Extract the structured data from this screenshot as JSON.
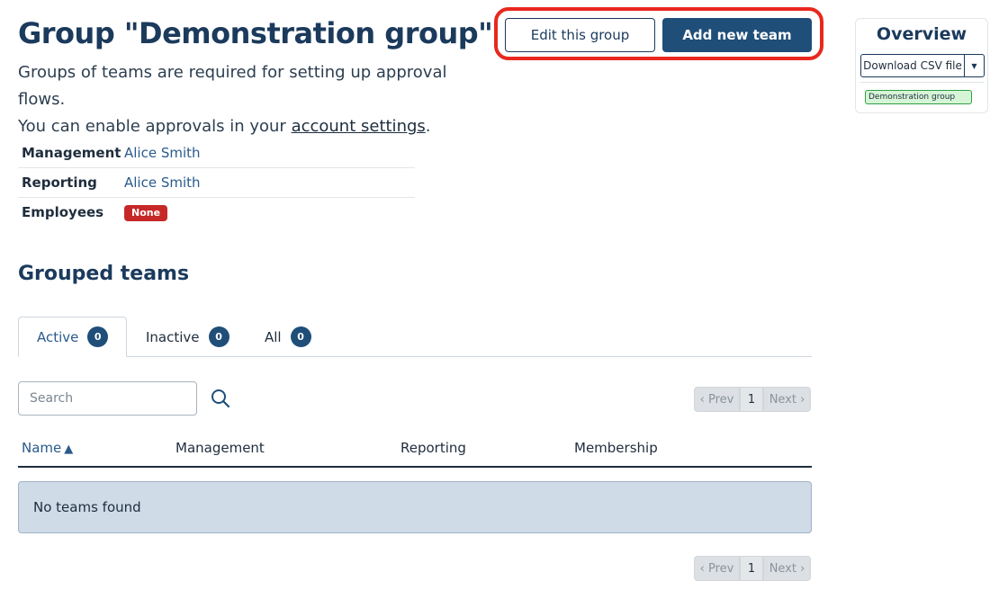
{
  "page": {
    "title": "Group \"Demonstration group\"",
    "description_line1": "Groups of teams are required for setting up approval flows.",
    "description_prefix": "You can enable approvals in your ",
    "description_link": "account settings",
    "description_suffix": "."
  },
  "actions": {
    "edit_label": "Edit this group",
    "add_label": "Add new team",
    "highlight_color": "#e8281e"
  },
  "overview": {
    "title": "Overview",
    "download_label": "Download CSV file",
    "group_chip": "Demonstration group"
  },
  "info": {
    "rows": [
      {
        "label": "Management",
        "value": "Alice Smith"
      },
      {
        "label": "Reporting",
        "value": "Alice Smith"
      },
      {
        "label": "Employees",
        "badge": "None"
      }
    ]
  },
  "grouped_teams": {
    "title": "Grouped teams",
    "tabs": [
      {
        "label": "Active",
        "count": "0"
      },
      {
        "label": "Inactive",
        "count": "0"
      },
      {
        "label": "All",
        "count": "0"
      }
    ],
    "search_placeholder": "Search",
    "pager": {
      "prev": "‹ Prev",
      "page": "1",
      "next": "Next ›"
    },
    "columns": [
      "Name",
      "Management",
      "Reporting",
      "Membership"
    ],
    "sort_indicator": "▲",
    "empty_message": "No teams found"
  },
  "colors": {
    "primary": "#1f4e79",
    "heading": "#1b3a5c",
    "danger": "#c62828",
    "empty_bg": "#cfdbe6"
  }
}
